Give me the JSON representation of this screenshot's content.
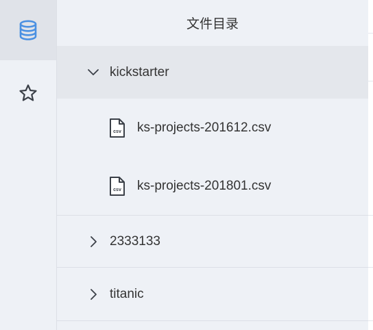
{
  "sidebar": {
    "items": [
      {
        "icon": "database-icon",
        "active": true
      },
      {
        "icon": "star-icon",
        "active": false
      }
    ]
  },
  "panel": {
    "title": "文件目录",
    "folders": [
      {
        "label": "kickstarter",
        "expanded": true,
        "files": [
          {
            "label": "ks-projects-201612.csv",
            "icon": "csv-file-icon",
            "icon_text": "csv"
          },
          {
            "label": "ks-projects-201801.csv",
            "icon": "csv-file-icon",
            "icon_text": "csv"
          }
        ]
      },
      {
        "label": "2333133",
        "expanded": false
      },
      {
        "label": "titanic",
        "expanded": false
      }
    ]
  },
  "colors": {
    "accent": "#4a90e2",
    "icon_gray": "#3a3f47",
    "background": "#eef1f6",
    "selected_row": "#e4e7ec"
  }
}
